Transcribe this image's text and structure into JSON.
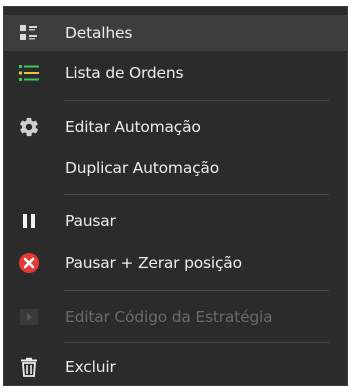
{
  "menu": {
    "items": [
      {
        "label": "Detalhes",
        "icon": "details-icon"
      },
      {
        "label": "Lista de Ordens",
        "icon": "order-list-icon"
      },
      {
        "label": "Editar Automação",
        "icon": "gear-icon"
      },
      {
        "label": "Duplicar Automação",
        "icon": ""
      },
      {
        "label": "Pausar",
        "icon": "pause-icon"
      },
      {
        "label": "Pausar + Zerar posição",
        "icon": "close-circle-icon"
      },
      {
        "label": "Editar Código da Estratégia",
        "icon": "play-icon",
        "disabled": true
      },
      {
        "label": "Excluir",
        "icon": "trash-icon"
      }
    ]
  },
  "colors": {
    "background": "#2b2b2b",
    "text": "#ececec",
    "disabled_text": "#6a6a6a",
    "separator": "#474747",
    "list_green": "#3cc45a",
    "list_yellow": "#e9c23a",
    "danger_red": "#e53935"
  }
}
